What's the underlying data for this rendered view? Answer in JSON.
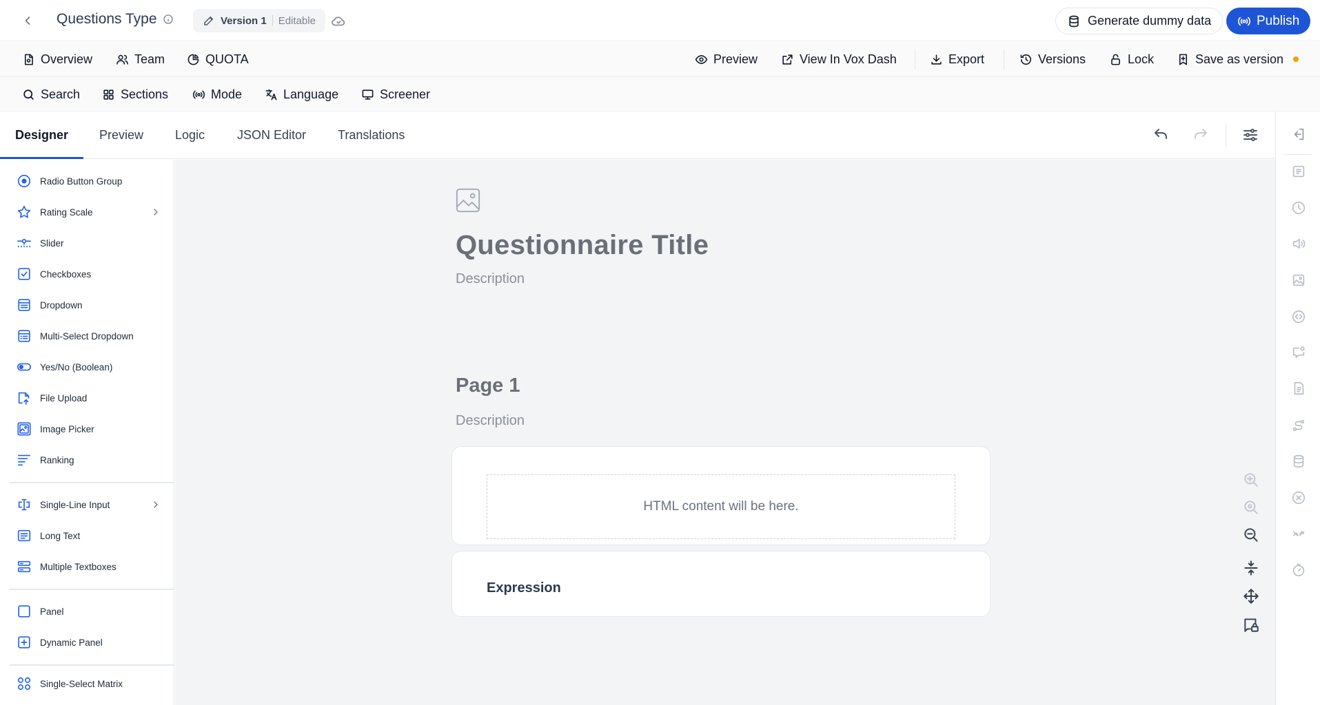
{
  "header": {
    "title": "Questions Type",
    "version_label": "Version 1",
    "version_status": "Editable",
    "generate_label": "Generate dummy data",
    "publish_label": "Publish"
  },
  "nav_primary": {
    "left": [
      "Overview",
      "Team",
      "QUOTA"
    ],
    "right": [
      "Preview",
      "View In Vox Dash",
      "Export",
      "Versions",
      "Lock",
      "Save as version"
    ]
  },
  "nav_secondary": [
    "Search",
    "Sections",
    "Mode",
    "Language",
    "Screener"
  ],
  "tabs": [
    "Designer",
    "Preview",
    "Logic",
    "JSON Editor",
    "Translations"
  ],
  "active_tab": "Designer",
  "toolbox": {
    "group1": [
      "Radio Button Group",
      "Rating Scale",
      "Slider",
      "Checkboxes",
      "Dropdown",
      "Multi-Select Dropdown",
      "Yes/No (Boolean)",
      "File Upload",
      "Image Picker",
      "Ranking"
    ],
    "group2": [
      "Single-Line Input",
      "Long Text",
      "Multiple Textboxes"
    ],
    "group3": [
      "Panel",
      "Dynamic Panel"
    ],
    "group4": [
      "Single-Select Matrix"
    ]
  },
  "survey": {
    "title": "Questionnaire Title",
    "description": "Description",
    "page_title": "Page 1",
    "page_description": "Description",
    "html_placeholder": "HTML content will be here.",
    "expression_label": "Expression"
  },
  "colors": {
    "accent": "#1e55d6",
    "icon_blue": "#2563eb",
    "unsaved_dot": "#f59e0b",
    "canvas_bg": "#f3f4f6"
  }
}
